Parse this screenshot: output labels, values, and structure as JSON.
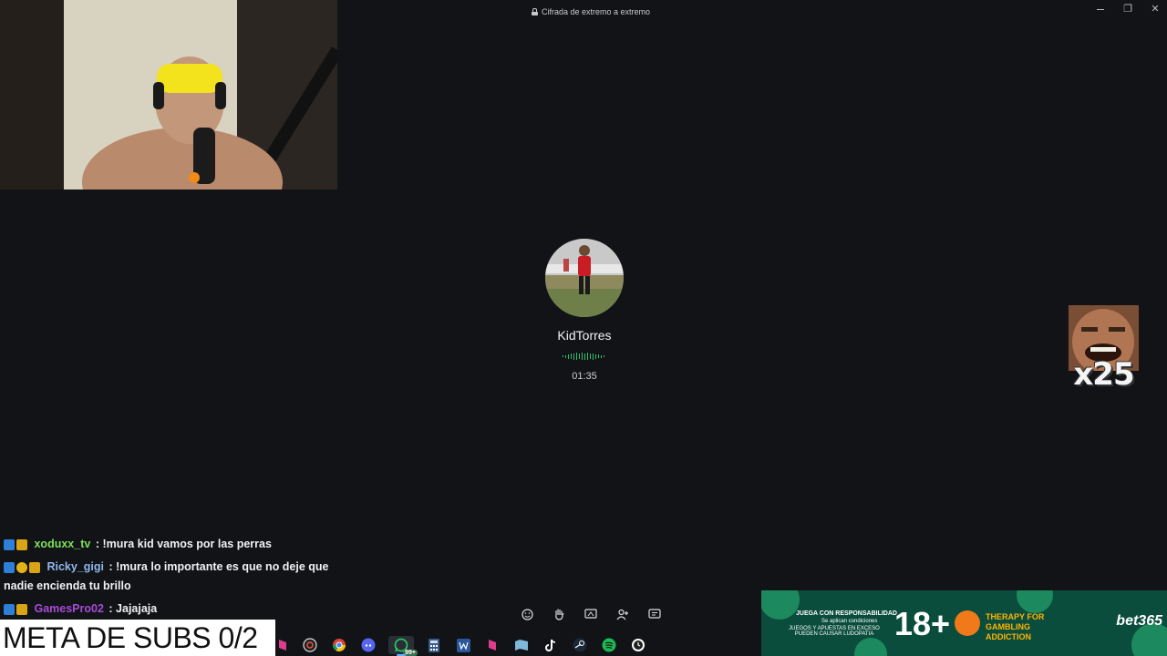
{
  "window": {
    "title": "Cifrada de extremo a extremo",
    "controls": {
      "minimize": "–",
      "restore": "❐",
      "close": "✕"
    }
  },
  "call": {
    "contact_name": "KidTorres",
    "duration": "01:35",
    "controls": [
      "emoji-icon",
      "raise-hand-icon",
      "share-screen-icon",
      "add-person-icon",
      "chat-icon"
    ]
  },
  "emote": {
    "label": "x25"
  },
  "chat": [
    {
      "username": "xoduxx_tv",
      "color": "#7ce05a",
      "badges": [
        "prime",
        "sub"
      ],
      "text": "!mura kid vamos por las perras"
    },
    {
      "username": "Ricky_gigi",
      "color": "#8fb8e8",
      "badges": [
        "prime",
        "one",
        "sub"
      ],
      "text": "!mura lo importante es que no deje que nadie encienda tu brillo"
    },
    {
      "username": "GamesPro02",
      "color": "#a64bd6",
      "badges": [
        "prime",
        "sub"
      ],
      "text": "Jajajaja"
    }
  ],
  "overlay": {
    "sub_goal": "META DE SUBS 0/2"
  },
  "taskbar": {
    "whatsapp_badge": "99+",
    "icons": [
      "app-pink-icon",
      "obs-icon",
      "chrome-icon",
      "discord-icon",
      "whatsapp-icon",
      "calculator-icon",
      "word-icon",
      "app-pink2-icon",
      "files-icon",
      "tiktok-icon",
      "steam-icon",
      "spotify-icon",
      "clock-icon"
    ]
  },
  "ad": {
    "line1": "JUEGA CON RESPONSABILIDAD",
    "line2": "Se aplican condiciones",
    "line3": "JUEGOS Y APUESTAS EN EXCESO PUEDEN CAUSAR LUDOPATIA",
    "age": "18+",
    "therapy": "THERAPY FOR GAMBLING ADDICTION",
    "logo": "bet365"
  }
}
